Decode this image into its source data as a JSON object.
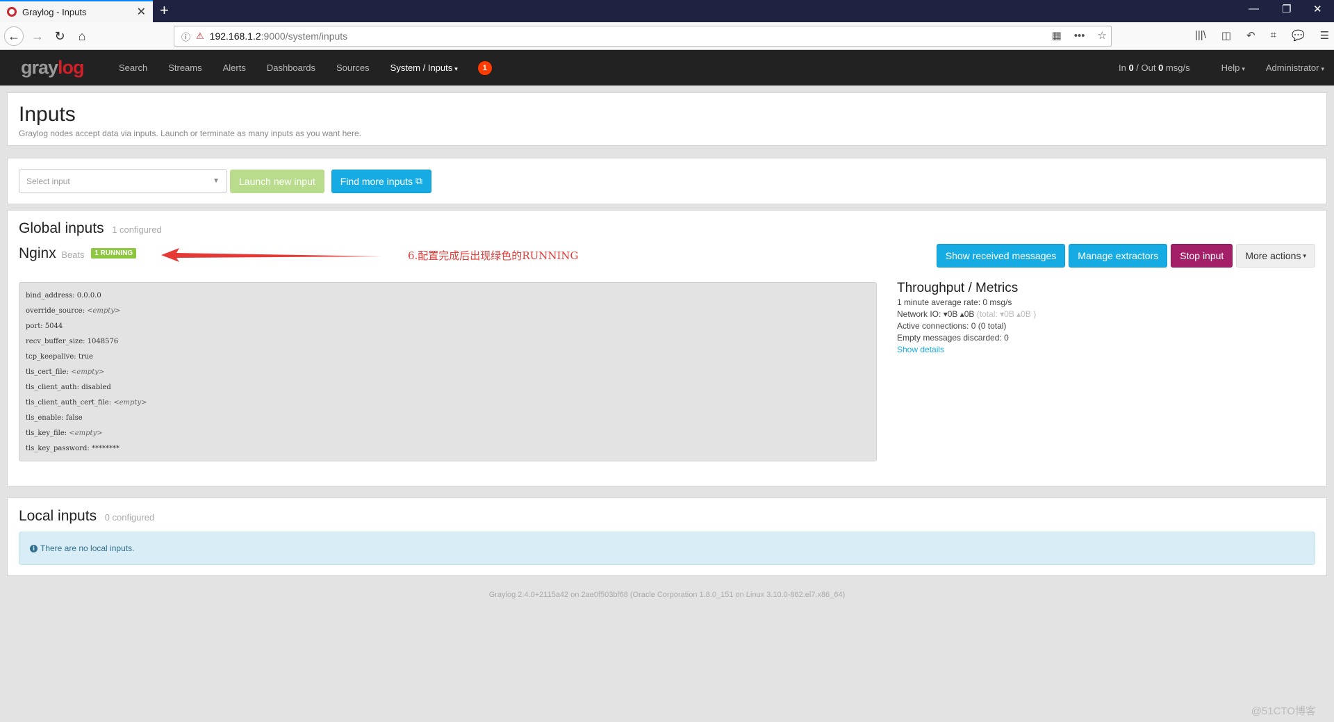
{
  "browser": {
    "tab_title": "Graylog - Inputs",
    "tab_close": "✕",
    "new_tab": "+",
    "window_controls": {
      "minimize": "—",
      "maximize": "❐",
      "close": "✕"
    },
    "nav": {
      "back": "←",
      "forward": "→",
      "reload": "↻",
      "home": "⌂"
    },
    "url": {
      "host": "192.168.1.2",
      "rest": ":9000/system/inputs",
      "info_icon": "ⓘ",
      "insecure_icon": "⚠"
    },
    "url_actions": {
      "qr": "▦",
      "more": "•••",
      "bookmark": "☆"
    },
    "toolbar_icons": [
      "library-icon",
      "sidebar-icon",
      "undo-icon",
      "crop-icon",
      "chat-icon",
      "menu-icon"
    ],
    "toolbar_glyphs": [
      "|||\\",
      "◫",
      "↶",
      "⌗",
      "💬",
      "☰"
    ]
  },
  "navbar": {
    "brand_gray": "gray",
    "brand_red": "log",
    "items": [
      {
        "label": "Search"
      },
      {
        "label": "Streams"
      },
      {
        "label": "Alerts"
      },
      {
        "label": "Dashboards"
      },
      {
        "label": "Sources"
      },
      {
        "label": "System / Inputs",
        "active": true,
        "dropdown": true
      }
    ],
    "notification_count": "1",
    "throughput": {
      "in_label": "In ",
      "in_value": "0",
      "sep": " / Out ",
      "out_value": "0",
      "unit": " msg/s"
    },
    "help": "Help",
    "user": "Administrator",
    "caret": "▾"
  },
  "page": {
    "title": "Inputs",
    "description": "Graylog nodes accept data via inputs. Launch or terminate as many inputs as you want here."
  },
  "launch": {
    "select_placeholder": "Select input",
    "select_caret": "▼",
    "launch_label": "Launch new input",
    "find_label": "Find more inputs",
    "external_icon": "⧉"
  },
  "global_inputs": {
    "title": "Global inputs",
    "count": "1 configured",
    "input": {
      "name": "Nginx",
      "type": "Beats",
      "status": "1 RUNNING",
      "annotation": "6.配置完成后出现绿色的RUNNING",
      "actions": {
        "show_messages": "Show received messages",
        "manage_extractors": "Manage extractors",
        "stop": "Stop input",
        "more": "More actions"
      },
      "config": [
        {
          "key": "bind_address",
          "value": "0.0.0.0",
          "empty": false
        },
        {
          "key": "override_source",
          "value": "<empty>",
          "empty": true
        },
        {
          "key": "port",
          "value": "5044",
          "empty": false
        },
        {
          "key": "recv_buffer_size",
          "value": "1048576",
          "empty": false
        },
        {
          "key": "tcp_keepalive",
          "value": "true",
          "empty": false
        },
        {
          "key": "tls_cert_file",
          "value": "<empty>",
          "empty": true
        },
        {
          "key": "tls_client_auth",
          "value": "disabled",
          "empty": false
        },
        {
          "key": "tls_client_auth_cert_file",
          "value": "<empty>",
          "empty": true
        },
        {
          "key": "tls_enable",
          "value": "false",
          "empty": false
        },
        {
          "key": "tls_key_file",
          "value": "<empty>",
          "empty": true
        },
        {
          "key": "tls_key_password",
          "value": "********",
          "empty": false
        }
      ],
      "metrics": {
        "title": "Throughput / Metrics",
        "avg_rate": "1 minute average rate: 0 msg/s",
        "network_label": "Network IO: ",
        "network_down": "▾0B",
        "network_up": "▴0B",
        "network_total": "(total: ▾0B ▴0B )",
        "active_connections": "Active connections: 0 (0 total)",
        "empty_discarded": "Empty messages discarded: 0",
        "show_details": "Show details"
      }
    }
  },
  "local_inputs": {
    "title": "Local inputs",
    "count": "0 configured",
    "info_icon": "i",
    "empty_message": "There are no local inputs."
  },
  "footer": "Graylog 2.4.0+2115a42 on 2ae0f503bf68 (Oracle Corporation 1.8.0_151 on Linux 3.10.0-862.el7.x86_64)",
  "watermark": "@51CTO博客",
  "colors": {
    "brand_red": "#d0202a",
    "info_blue": "#16ace3",
    "stop_purple": "#a31f68",
    "running_green": "#8dc63f",
    "launch_green_disabled": "#b8dc8b",
    "annotation_red": "#e53935"
  }
}
